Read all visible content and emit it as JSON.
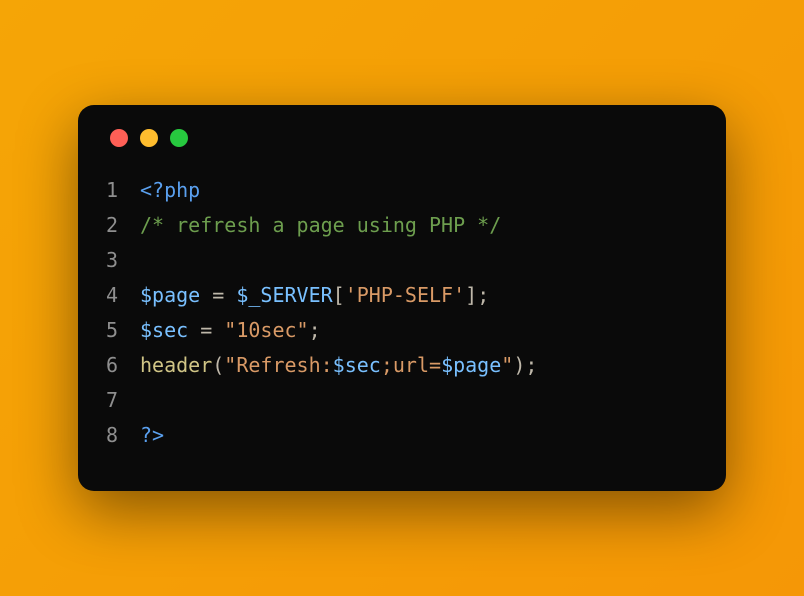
{
  "traffic_lights": {
    "red": "#ff5f56",
    "yellow": "#ffbd2e",
    "green": "#27c93f"
  },
  "code": {
    "lines": [
      {
        "n": "1",
        "tokens": [
          {
            "c": "tok-tag",
            "t": "<?php"
          }
        ]
      },
      {
        "n": "2",
        "tokens": [
          {
            "c": "tok-comment",
            "t": "/* refresh a page using PHP */"
          }
        ]
      },
      {
        "n": "3",
        "tokens": [
          {
            "c": "tok-op",
            "t": ""
          }
        ]
      },
      {
        "n": "4",
        "tokens": [
          {
            "c": "tok-var",
            "t": "$page"
          },
          {
            "c": "tok-op",
            "t": " = "
          },
          {
            "c": "tok-var",
            "t": "$_SERVER"
          },
          {
            "c": "tok-bracket",
            "t": "["
          },
          {
            "c": "tok-str",
            "t": "'PHP-SELF'"
          },
          {
            "c": "tok-bracket",
            "t": "]"
          },
          {
            "c": "tok-punct",
            "t": ";"
          }
        ]
      },
      {
        "n": "5",
        "tokens": [
          {
            "c": "tok-var",
            "t": "$sec"
          },
          {
            "c": "tok-op",
            "t": " = "
          },
          {
            "c": "tok-str",
            "t": "\"10sec\""
          },
          {
            "c": "tok-punct",
            "t": ";"
          }
        ]
      },
      {
        "n": "6",
        "tokens": [
          {
            "c": "tok-func",
            "t": "header"
          },
          {
            "c": "tok-bracket",
            "t": "("
          },
          {
            "c": "tok-str",
            "t": "\"Refresh:"
          },
          {
            "c": "tok-var",
            "t": "$sec"
          },
          {
            "c": "tok-str",
            "t": ";url="
          },
          {
            "c": "tok-var",
            "t": "$page"
          },
          {
            "c": "tok-str",
            "t": "\""
          },
          {
            "c": "tok-bracket",
            "t": ")"
          },
          {
            "c": "tok-punct",
            "t": ";"
          }
        ]
      },
      {
        "n": "7",
        "tokens": [
          {
            "c": "tok-op",
            "t": ""
          }
        ]
      },
      {
        "n": "8",
        "tokens": [
          {
            "c": "tok-tag",
            "t": "?>"
          }
        ]
      }
    ]
  }
}
